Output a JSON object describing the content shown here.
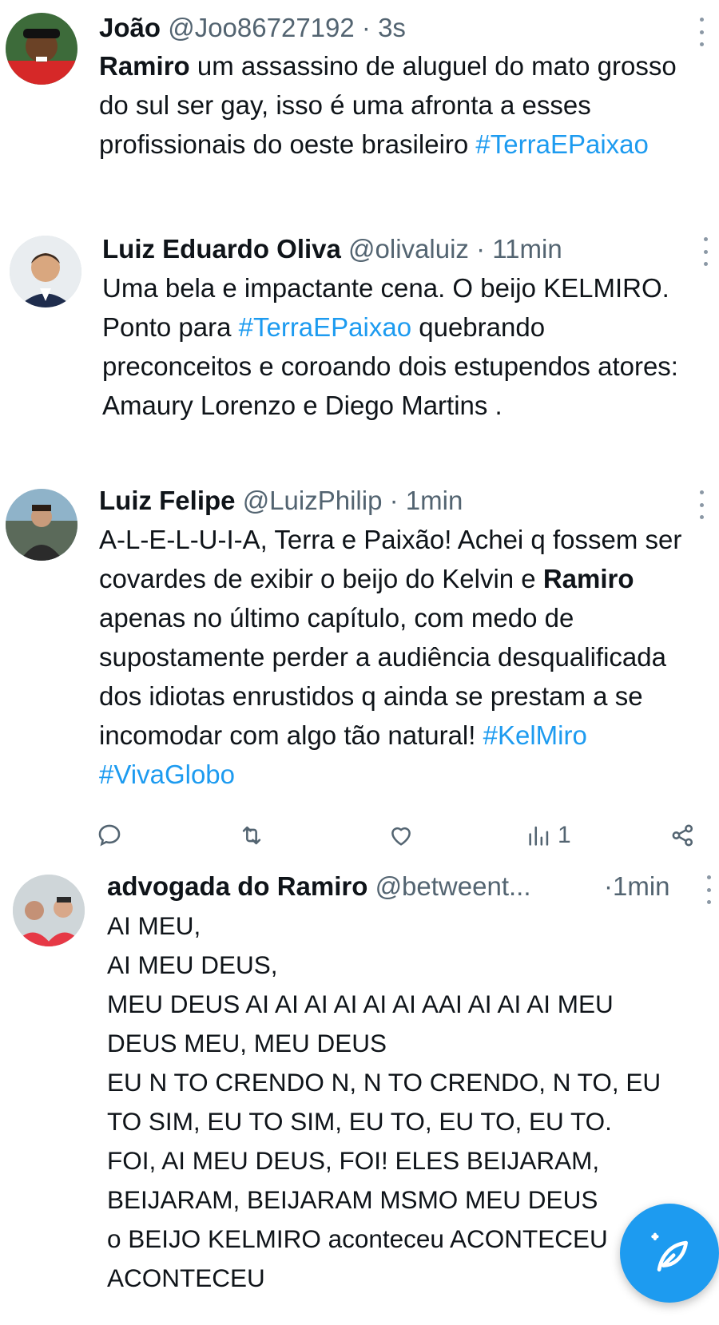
{
  "tweets": [
    {
      "name": "João",
      "handle": "@Joo86727192",
      "dot": "·",
      "time": "3s",
      "body": [
        {
          "text": "Ramiro",
          "type": "mention"
        },
        {
          "text": " um assassino de aluguel do mato grosso do sul ser gay, isso é uma afronta a esses profissionais do oeste brasileiro ",
          "type": "text"
        },
        {
          "text": "#TerraEPaixao",
          "type": "tag"
        }
      ]
    },
    {
      "name": "Luiz Eduardo Oliva",
      "handle": "@olivaluiz",
      "dot": "·",
      "time": "11min",
      "body": [
        {
          "text": "Uma bela e impactante cena. O beijo KELMIRO. Ponto para ",
          "type": "text"
        },
        {
          "text": "#TerraEPaixao",
          "type": "tag"
        },
        {
          "text": " quebrando preconceitos e coroando dois estupendos atores: Amaury Lorenzo e Diego Martins .",
          "type": "text"
        }
      ]
    },
    {
      "name": "Luiz Felipe",
      "handle": "@LuizPhilip",
      "dot": "·",
      "time": "1min",
      "body": [
        {
          "text": "A-L-E-L-U-I-A, Terra e Paixão! Achei q fossem ser covardes de exibir o beijo do Kelvin e ",
          "type": "text"
        },
        {
          "text": "Ramiro",
          "type": "mention"
        },
        {
          "text": " apenas no último capítulo, com medo de supostamente perder a audiência desqualificada dos idiotas enrustidos q ainda se prestam a se incomodar com algo tão natural! ",
          "type": "text"
        },
        {
          "text": "#KelMiro",
          "type": "tag"
        },
        {
          "text": " ",
          "type": "text"
        },
        {
          "text": "#VivaGlobo",
          "type": "tag"
        }
      ],
      "actions": {
        "reply_icon": "reply-icon",
        "retweet_icon": "retweet-icon",
        "like_icon": "heart-icon",
        "views_icon": "views-icon",
        "views_count": "1",
        "share_icon": "share-icon"
      }
    },
    {
      "name": "advogada do Ramiro",
      "handle": "@betweent...",
      "dot": "·",
      "time": "1min",
      "lines": [
        "AI MEU,",
        "AI MEU DEUS,",
        "MEU DEUS AI AI AI AI AI AI AAI AI AI AI MEU",
        "DEUS MEU, MEU DEUS",
        "EU N TO CRENDO N, N TO CRENDO, N TO, EU",
        "TO SIM, EU TO SIM, EU TO, EU TO, EU TO.",
        "FOI, AI MEU DEUS, FOI! ELES BEIJARAM,",
        "BEIJARAM, BEIJARAM MSMO MEU DEUS",
        "o BEIJO KELMIRO aconteceu ACONTECEU",
        "ACONTECEU"
      ]
    }
  ],
  "colors": {
    "accent": "#1d9bf0",
    "muted": "#536471",
    "text": "#0f1419"
  },
  "fab": {
    "icon": "compose-icon"
  }
}
